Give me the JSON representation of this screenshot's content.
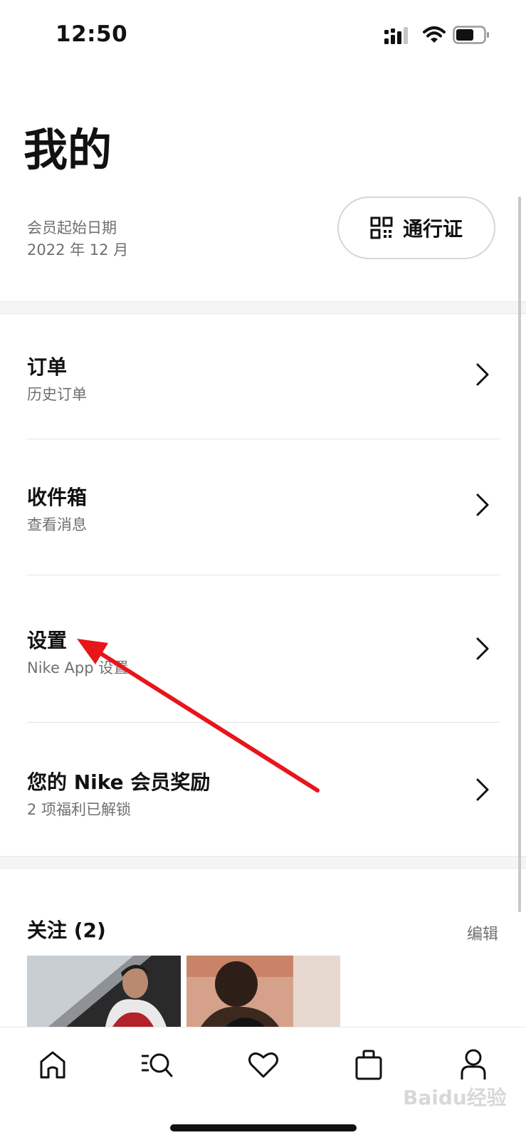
{
  "status_bar": {
    "time": "12:50"
  },
  "header": {
    "title": "我的",
    "member_label": "会员起始日期",
    "member_date": "2022 年 12 月",
    "pass_button_label": "通行证"
  },
  "menu": [
    {
      "title": "订单",
      "subtitle": "历史订单"
    },
    {
      "title": "收件箱",
      "subtitle": "查看消息"
    },
    {
      "title": "设置",
      "subtitle": "Nike App 设置"
    },
    {
      "title": "您的 Nike 会员奖励",
      "subtitle": "2 项福利已解锁"
    }
  ],
  "following": {
    "title": "关注 (2)",
    "edit_label": "编辑"
  },
  "bottom_nav": [
    "home-icon",
    "search-icon",
    "heart-icon",
    "bag-icon",
    "profile-icon"
  ],
  "colors": {
    "accent_arrow": "#e8151b",
    "text_primary": "#111111",
    "text_secondary": "#707070"
  }
}
